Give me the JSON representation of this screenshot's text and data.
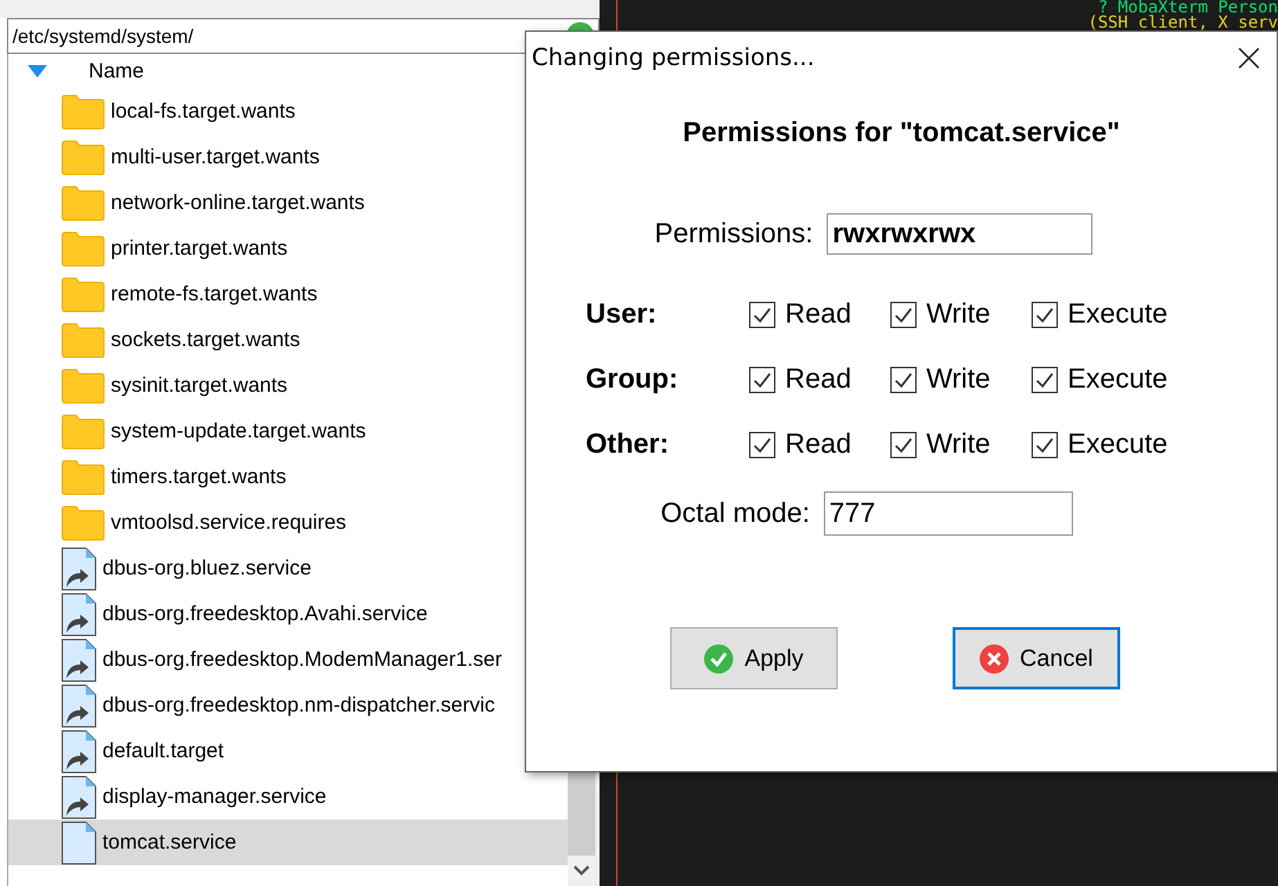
{
  "file_browser": {
    "path": "/etc/systemd/system/",
    "column_header": "Name",
    "items": [
      {
        "kind": "folder",
        "name": "local-fs.target.wants",
        "selected": false
      },
      {
        "kind": "folder",
        "name": "multi-user.target.wants",
        "selected": false
      },
      {
        "kind": "folder",
        "name": "network-online.target.wants",
        "selected": false
      },
      {
        "kind": "folder",
        "name": "printer.target.wants",
        "selected": false
      },
      {
        "kind": "folder",
        "name": "remote-fs.target.wants",
        "selected": false
      },
      {
        "kind": "folder",
        "name": "sockets.target.wants",
        "selected": false
      },
      {
        "kind": "folder",
        "name": "sysinit.target.wants",
        "selected": false
      },
      {
        "kind": "folder",
        "name": "system-update.target.wants",
        "selected": false
      },
      {
        "kind": "folder",
        "name": "timers.target.wants",
        "selected": false
      },
      {
        "kind": "folder",
        "name": "vmtoolsd.service.requires",
        "selected": false
      },
      {
        "kind": "link",
        "name": "dbus-org.bluez.service",
        "selected": false
      },
      {
        "kind": "link",
        "name": "dbus-org.freedesktop.Avahi.service",
        "selected": false
      },
      {
        "kind": "link",
        "name": "dbus-org.freedesktop.ModemManager1.ser",
        "selected": false
      },
      {
        "kind": "link",
        "name": "dbus-org.freedesktop.nm-dispatcher.servic",
        "selected": false
      },
      {
        "kind": "link",
        "name": "default.target",
        "selected": false
      },
      {
        "kind": "link",
        "name": "display-manager.service",
        "selected": false
      },
      {
        "kind": "file",
        "name": "tomcat.service",
        "selected": true
      }
    ]
  },
  "terminal": {
    "lines": [
      "? MobaXterm Person",
      "(SSH client, X serv"
    ]
  },
  "dialog": {
    "title": "Changing permissions...",
    "heading": "Permissions for \"tomcat.service\"",
    "permissions_label": "Permissions:",
    "permissions_value": "rwxrwxrwx",
    "rows": [
      {
        "label": "User:",
        "options": [
          {
            "label": "Read",
            "checked": true
          },
          {
            "label": "Write",
            "checked": true
          },
          {
            "label": "Execute",
            "checked": true
          }
        ]
      },
      {
        "label": "Group:",
        "options": [
          {
            "label": "Read",
            "checked": true
          },
          {
            "label": "Write",
            "checked": true
          },
          {
            "label": "Execute",
            "checked": true
          }
        ]
      },
      {
        "label": "Other:",
        "options": [
          {
            "label": "Read",
            "checked": true
          },
          {
            "label": "Write",
            "checked": true
          },
          {
            "label": "Execute",
            "checked": true
          }
        ]
      }
    ],
    "octal_label": "Octal mode:",
    "octal_value": "777",
    "buttons": [
      {
        "kind": "apply",
        "label": "Apply",
        "focused": false
      },
      {
        "kind": "cancel",
        "label": "Cancel",
        "focused": true
      }
    ]
  }
}
